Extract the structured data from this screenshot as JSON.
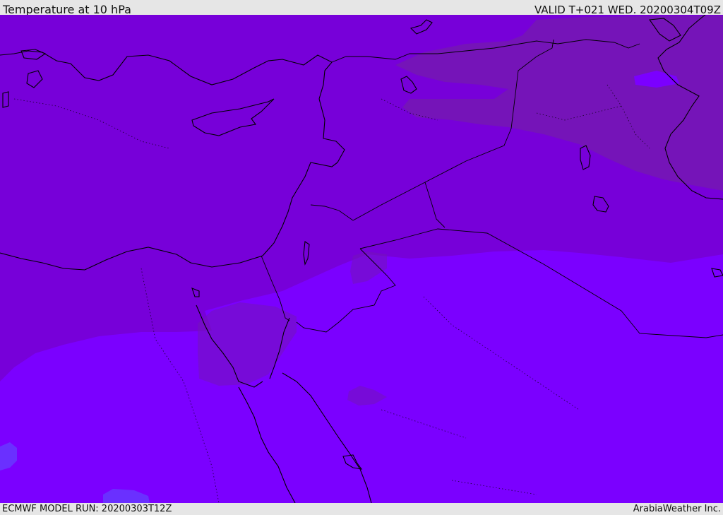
{
  "header": {
    "title": "Temperature at 10 hPa",
    "valid_time": "VALID T+021 WED. 20200304T09Z"
  },
  "footer": {
    "model_run": "ECMWF MODEL RUN: 20200303T12Z",
    "brand": "ArabiaWeather Inc."
  },
  "colors": {
    "cold_band": "#7700d9",
    "colder_band": "#7b00ff",
    "warm_band": "#7514b8",
    "coldest_patch": "#6a30ff",
    "coastline": "#000000",
    "background": "#e6e6e6"
  }
}
